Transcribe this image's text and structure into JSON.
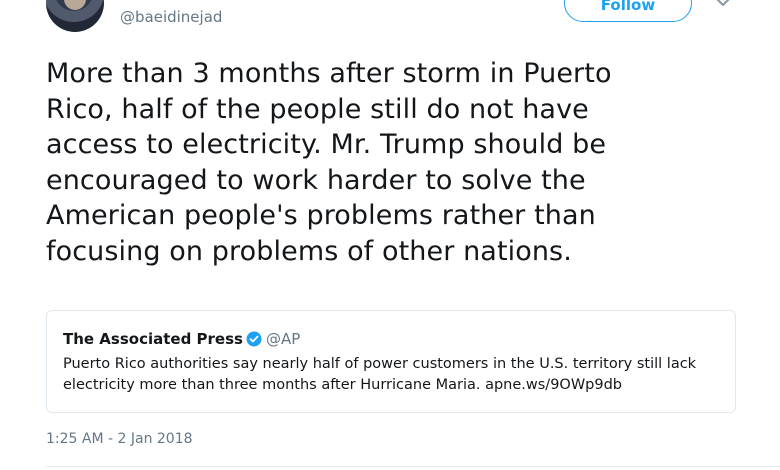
{
  "author": {
    "handle": "@baeidinejad"
  },
  "follow_button": {
    "label": "Follow"
  },
  "tweet": {
    "lines": [
      "More than 3 months after storm in Puerto",
      "Rico, half of the people still do not have",
      "access to electricity. Mr. Trump should be",
      "encouraged to work harder to solve the",
      "American people's problems rather than",
      "focusing on problems of other nations."
    ],
    "timestamp": "1:25 AM - 2 Jan 2018"
  },
  "quoted_tweet": {
    "name": "The Associated Press",
    "handle": "@AP",
    "verified": true,
    "lines": [
      "Puerto Rico authorities say nearly half of power customers in the U.S. territory still lack",
      "electricity more than three months after Hurricane Maria. apne.ws/9OWp9db"
    ]
  },
  "icons": {
    "menu": "chevron-down-icon",
    "verified": "verified-badge-icon"
  },
  "colors": {
    "accent": "#1da1f2",
    "text": "#14171a",
    "secondary": "#657786",
    "border": "#e1e8ed"
  }
}
